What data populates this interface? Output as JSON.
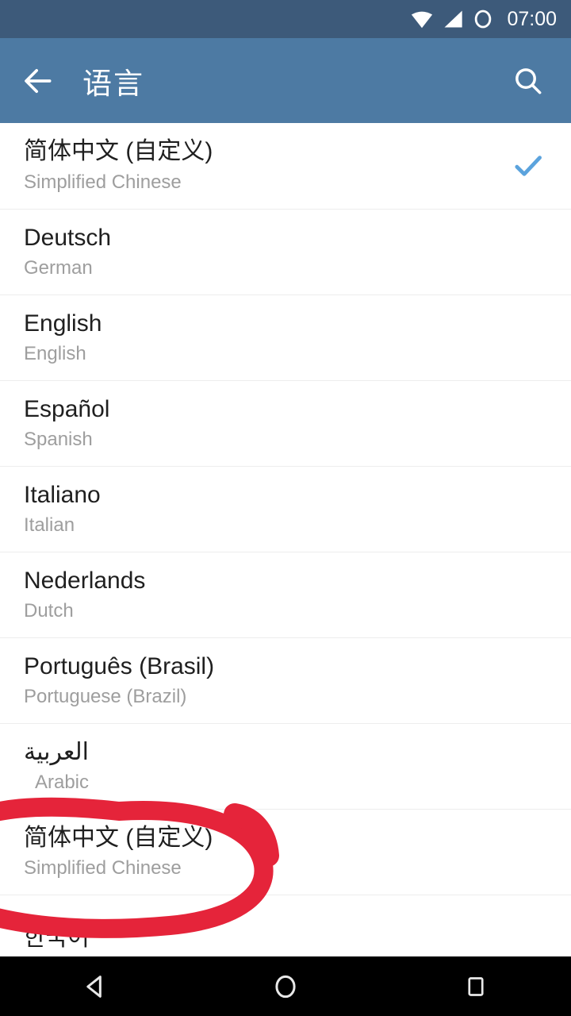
{
  "status_bar": {
    "time": "07:00",
    "background_color": "#3d5a7a",
    "icons": [
      "wifi-icon",
      "signal-icon",
      "battery-circle-icon"
    ]
  },
  "app_bar": {
    "title": "语言",
    "back_icon": "arrow-left-icon",
    "search_icon": "search-icon",
    "background_color": "#4d7aa3",
    "text_color": "#ffffff"
  },
  "list": {
    "check_color": "#5ba3dd",
    "divider_color": "#ededed",
    "title_color": "#1f1f1f",
    "subtitle_color": "#9e9e9e",
    "items": [
      {
        "title": "简体中文 (自定义)",
        "subtitle": "Simplified Chinese",
        "selected": true,
        "rtl": false
      },
      {
        "title": "Deutsch",
        "subtitle": "German",
        "selected": false,
        "rtl": false
      },
      {
        "title": "English",
        "subtitle": "English",
        "selected": false,
        "rtl": false
      },
      {
        "title": "Español",
        "subtitle": "Spanish",
        "selected": false,
        "rtl": false
      },
      {
        "title": "Italiano",
        "subtitle": "Italian",
        "selected": false,
        "rtl": false
      },
      {
        "title": "Nederlands",
        "subtitle": "Dutch",
        "selected": false,
        "rtl": false
      },
      {
        "title": "Português (Brasil)",
        "subtitle": "Portuguese (Brazil)",
        "selected": false,
        "rtl": false
      },
      {
        "title": "العربية",
        "subtitle": "Arabic",
        "selected": false,
        "rtl": true
      },
      {
        "title": "简体中文 (自定义)",
        "subtitle": "Simplified Chinese",
        "selected": false,
        "rtl": false
      },
      {
        "title": "한국어",
        "subtitle": "",
        "selected": false,
        "rtl": false
      }
    ]
  },
  "annotation": {
    "shape": "hand-drawn-red-ellipse",
    "color": "#e5243a",
    "target_item_index": 8,
    "stroke_width": 24
  },
  "nav_bar": {
    "background_color": "#000000",
    "buttons": [
      {
        "name": "back-nav-button",
        "icon": "triangle-left-icon"
      },
      {
        "name": "home-nav-button",
        "icon": "circle-icon"
      },
      {
        "name": "recents-nav-button",
        "icon": "square-icon"
      }
    ]
  }
}
